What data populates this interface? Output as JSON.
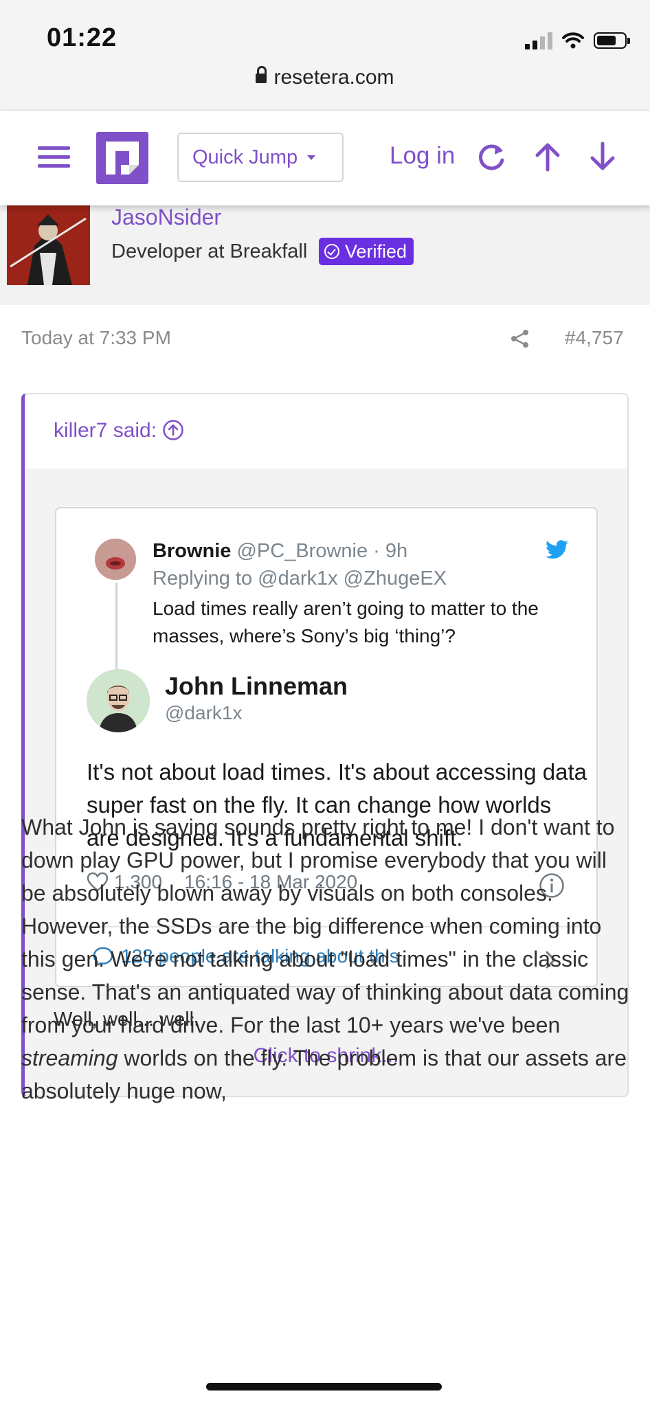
{
  "status_bar": {
    "time": "01:22"
  },
  "browser": {
    "url": "resetera.com"
  },
  "nav": {
    "quick_jump": "Quick Jump",
    "login": "Log in"
  },
  "author": {
    "name": "JasoNsider",
    "title": "Developer at Breakfall",
    "badge": "Verified"
  },
  "post": {
    "date": "Today at 7:33 PM",
    "number": "#4,757",
    "quote": {
      "author": "killer7 said:",
      "tweet": {
        "reply_author": "Brownie",
        "reply_handle": "@PC_Brownie · 9h",
        "reply_to": "Replying to @dark1x @ZhugeEX",
        "reply_text": "Load times really aren’t going to matter to the masses, where’s Sony’s big ‘thing’?",
        "author": "John Linneman",
        "handle": "@dark1x",
        "body": "It's not about load times. It's about accessing data super fast on the fly. It can change how worlds are designed. It's a fundamental shift.",
        "likes": "1,300",
        "timestamp": "16:16 - 18 Mar 2020",
        "talking": "128 people are talking about this"
      },
      "text": "Well, well... well.",
      "shrink": "Click to shrink..."
    },
    "body_part1": "What John is saying sounds pretty right to me! I don't want to down play GPU power, but I promise everybody that you will be absolutely blown away by visuals on both consoles. However, the SSDs are the big difference when coming into this gen. We're not talking about \"load times\" in the classic sense. That's an antiquated way of thinking about data coming from your hard drive. For the last 10+ years we've been ",
    "body_emphasis": "streaming",
    "body_part2": " worlds on the fly. The problem is that our assets are absolutely huge now,"
  },
  "colors": {
    "accent": "#7f50c8",
    "verified_bg": "#6a2fe0",
    "twitter_blue": "#1da1f2",
    "link_blue": "#2f7db8"
  },
  "icons": [
    "signal-icon",
    "wifi-icon",
    "battery-icon",
    "lock-icon",
    "hamburger-icon",
    "site-logo",
    "caret-down-icon",
    "refresh-icon",
    "arrow-up-icon",
    "arrow-down-icon",
    "verified-check-icon",
    "share-icon",
    "quote-up-icon",
    "twitter-bird-icon",
    "heart-icon",
    "info-icon",
    "speech-bubble-icon",
    "chevron-right-icon"
  ]
}
